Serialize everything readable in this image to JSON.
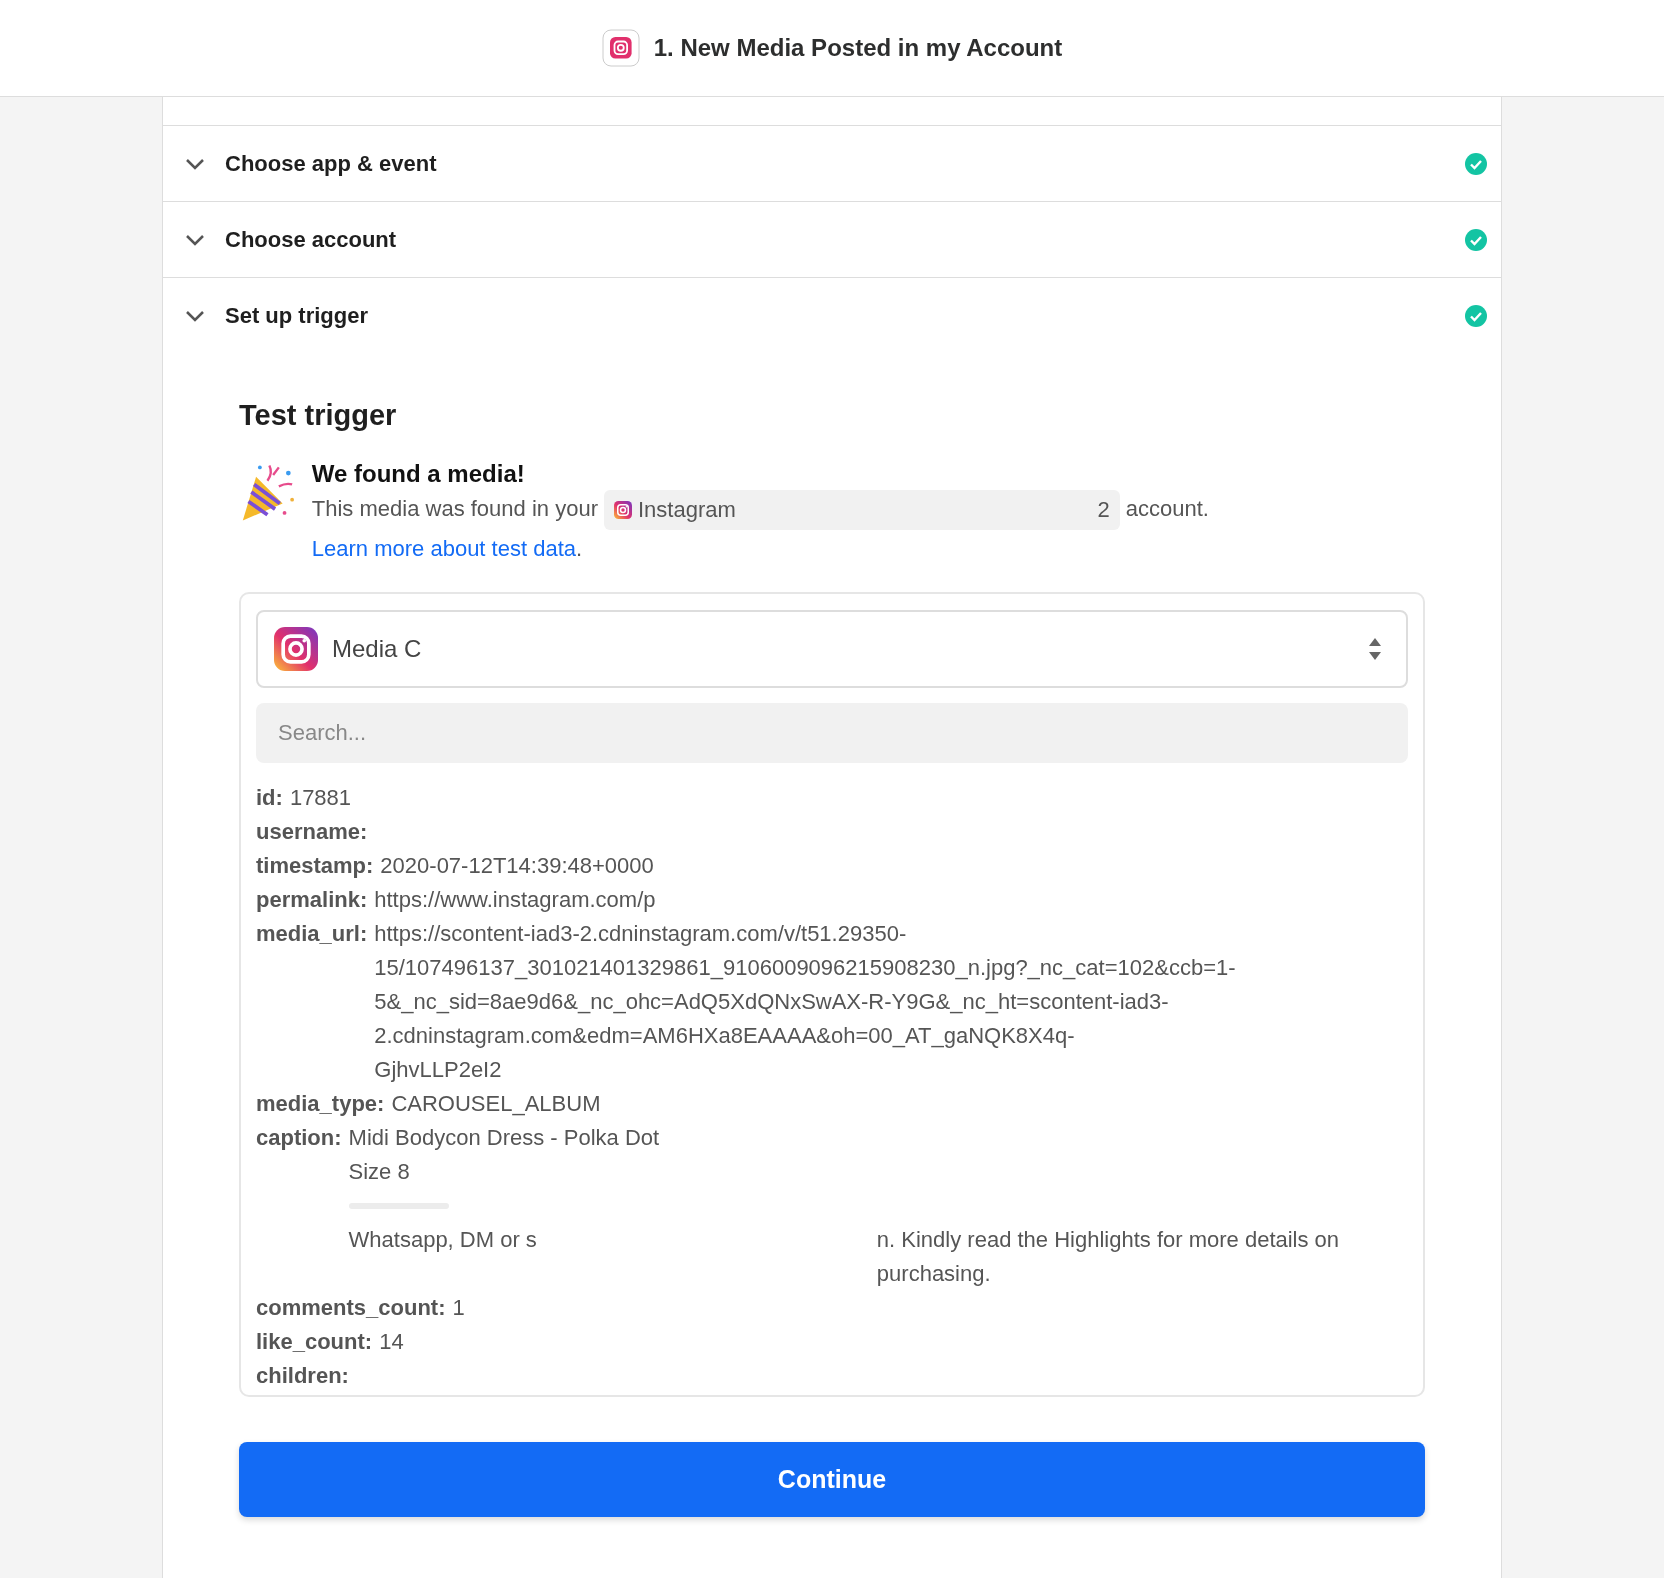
{
  "header": {
    "title": "1. New Media Posted in my Account"
  },
  "steps": [
    {
      "label": "Choose app & event",
      "done": true,
      "expanded": false
    },
    {
      "label": "Choose account",
      "done": true,
      "expanded": false
    },
    {
      "label": "Set up trigger",
      "done": true,
      "expanded": false
    }
  ],
  "test": {
    "heading": "Test trigger",
    "found_title": "We found a media!",
    "found_text_before": "This media was found in your",
    "chip": {
      "label": "Instagram",
      "suffix": "2"
    },
    "found_text_after": "account.",
    "link": "Learn more about test data",
    "period": ".",
    "select": {
      "value": "Media C"
    },
    "search": {
      "placeholder": "Search..."
    },
    "fields": [
      {
        "key": "id:",
        "lines": [
          {
            "parts": [
              "17881"
            ]
          }
        ]
      },
      {
        "key": "username:"
      },
      {
        "key": "timestamp:",
        "lines": [
          {
            "parts": [
              "2020-07-12T14:39:48+0000"
            ]
          }
        ]
      },
      {
        "key": "permalink:",
        "lines": [
          {
            "parts": [
              "https://www.instagram.com/p"
            ]
          }
        ]
      },
      {
        "key": "media_url:",
        "lines": [
          {
            "parts": [
              "https://scontent-iad3-2.cdninstagram.com/v/t51.29350-"
            ]
          },
          {
            "parts": [
              "15/107496137_301021401329861_9106009096215908230_n.jpg?_nc_cat=102&ccb=1-"
            ]
          },
          {
            "parts": [
              "5&_nc_sid=8ae9d6&_nc_ohc=AdQ5XdQNxSwAX-R-Y9G&_nc_ht=scontent-iad3-"
            ]
          },
          {
            "parts": [
              "2.cdninstagram.com&edm=AM6HXa8EAAAA&oh=00_AT_gaNQK8X4q-"
            ]
          },
          {
            "parts": [
              "GjhvLLP2eI2"
            ]
          }
        ]
      },
      {
        "key": "media_type:",
        "lines": [
          {
            "parts": [
              "CAROUSEL_ALBUM"
            ]
          }
        ]
      },
      {
        "key": "caption:",
        "lines": [
          {
            "kind": "text",
            "parts": [
              "Midi Bodycon Dress - Polka Dot"
            ]
          },
          {
            "kind": "text",
            "parts": [
              "Size 8"
            ]
          },
          {
            "kind": "redacted"
          },
          {
            "kind": "text",
            "parts": [
              "Whatsapp, DM or s",
              "n. Kindly read the Highlights for more details on purchasing."
            ]
          }
        ]
      },
      {
        "key": "comments_count:",
        "lines": [
          {
            "parts": [
              "1"
            ]
          }
        ]
      },
      {
        "key": "like_count:",
        "lines": [
          {
            "parts": [
              "14"
            ]
          }
        ]
      },
      {
        "key": "children:"
      }
    ],
    "button": "Continue"
  }
}
